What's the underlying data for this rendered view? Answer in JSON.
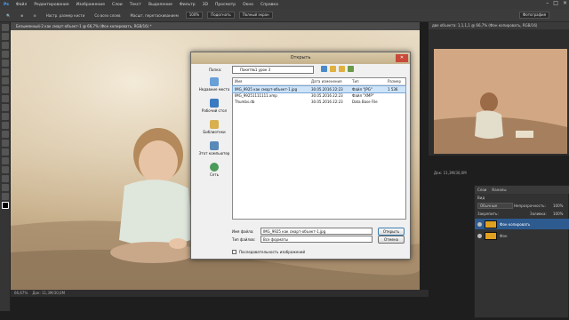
{
  "menu": [
    "Файл",
    "Редактирование",
    "Изображение",
    "Слои",
    "Текст",
    "Выделение",
    "Фильтр",
    "3D",
    "Просмотр",
    "Окно",
    "Справка"
  ],
  "options": {
    "sample_size": "Настр. размер кисти",
    "all_layers": "Со всех слоев",
    "auto_enhance": "Масшт. перетаскиванием",
    "zoom_100": "100%",
    "fit_screen": "Подогнать",
    "fill_screen": "Полный экран",
    "workspace": "Фотография"
  },
  "doc_tab": "Безымянный-2 как смарт-объект-1 @ 66,7% (Фон копировать, RGB/16) *",
  "status_left": "66,67%",
  "status_doc": "Док: 11,3М/30,0М",
  "navigator": {
    "tab": "Навигатор",
    "title": "две объекта: 1,1,1,1 @ 66,7% (Фон копировать, RGB/16)",
    "zoom": "Док: 11,3М/30,0М"
  },
  "layers": {
    "tabs": [
      "Слои",
      "Каналы"
    ],
    "kind": "Вид",
    "mode": "Обычные",
    "opacity_label": "Непрозрачность:",
    "opacity_value": "100%",
    "lock_label": "Закрепить:",
    "fill_label": "Заливка:",
    "fill_value": "100%",
    "items": [
      {
        "name": "Фон копировать",
        "selected": true
      },
      {
        "name": "Фон",
        "selected": false
      }
    ]
  },
  "dialog": {
    "title": "Открыть",
    "folder_label": "Папка:",
    "folder_value": "Пакет№1 урок 3",
    "places": [
      "Недавние места",
      "Рабочий стол",
      "Библиотеки",
      "Этот компьютер",
      "Сеть"
    ],
    "columns": [
      "Имя",
      "Дата изменения",
      "Тип",
      "Размер"
    ],
    "files": [
      {
        "name": "IMG_9925 как смарт-объект-1.jpg",
        "date": "30.05.2016 22:23",
        "type": "Файл \"JPG\"",
        "size": "1 536",
        "selected": true
      },
      {
        "name": "IMG_99251111111.xmp",
        "date": "30.05.2016 22:23",
        "type": "Файл \"XMP\"",
        "size": "",
        "selected": false
      },
      {
        "name": "Thumbs.db",
        "date": "30.05.2016 22:23",
        "type": "Data Base File",
        "size": "",
        "selected": false
      }
    ],
    "filename_label": "Имя файла:",
    "filename_value": "IMG_9925 как смарт-объект-1.jpg",
    "filetype_label": "Тип файлов:",
    "filetype_value": "Все форматы",
    "open_label": "Открыть",
    "cancel_label": "Отмена",
    "sequence_label": "Последовательность изображений"
  }
}
